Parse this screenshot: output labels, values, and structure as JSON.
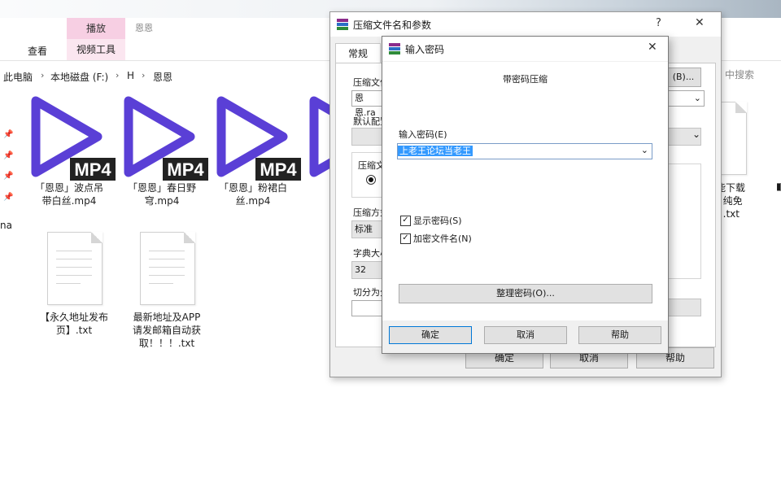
{
  "ribbon": {
    "play_tab": "播放",
    "context_title": "恩恩",
    "view_tab": "查看",
    "video_tools": "视频工具"
  },
  "address": {
    "crumbs": [
      "此电脑",
      "本地磁盘 (F:)",
      "H",
      "恩恩"
    ],
    "search_placeholder": "中搜索",
    "left_partial": "na"
  },
  "files": [
    {
      "name": "「恩恩」波点吊带白丝.mp4",
      "line1": "「恩恩」波点吊",
      "line2": "带白丝.mp4",
      "badge": "MP4"
    },
    {
      "name": "「恩恩」春日野穹.mp4",
      "line1": "「恩恩」春日野",
      "line2": "穹.mp4",
      "badge": "MP4"
    },
    {
      "name": "「恩恩」粉裙白丝.mp4",
      "line1": "「恩恩」粉裙白",
      "line2": "丝.mp4",
      "badge": "MP4"
    },
    {
      "name": "「",
      "line1": "「",
      "line2": "",
      "badge": ""
    },
    {
      "name": "【永久地址发布页】.txt",
      "line1": "【永久地址发布",
      "line2": "页】.txt"
    },
    {
      "name": "最新地址及APP请发邮箱自动获取！！！.txt",
      "line1": "最新地址及APP",
      "line2": "请发邮箱自动获",
      "line3": "取！！！.txt"
    },
    {
      "name": "能下载 纯免 .txt",
      "line1": "能下载",
      "line2": "! 纯免",
      "line3": "! .txt"
    }
  ],
  "archive_dialog": {
    "title": "压缩文件名和参数",
    "help_glyph": "?",
    "close_glyph": "✕",
    "tab_general": "常规",
    "archive_name_label": "压缩文件",
    "archive_name_value": "恩恩.ra",
    "browse_button": "(B)...",
    "default_profile_label": "默认配置",
    "format_label": "压缩文",
    "method_label": "压缩方式",
    "method_value": "标准",
    "dict_label": "字典大小",
    "dict_value": "32",
    "split_label": "切分为分",
    "ok_button": "确定",
    "cancel_button": "取消",
    "help_button": "帮助"
  },
  "password_dialog": {
    "title": "输入密码",
    "close_glyph": "✕",
    "subtitle": "带密码压缩",
    "enter_label": "输入密码(E)",
    "password_value": "上老王论坛当老王",
    "show_password": "显示密码(S)",
    "show_password_checked": true,
    "encrypt_names": "加密文件名(N)",
    "encrypt_names_checked": true,
    "organize_button": "整理密码(O)...",
    "ok_button": "确定",
    "cancel_button": "取消",
    "help_button": "帮助"
  },
  "colors": {
    "play_purple": "#5a3fd6",
    "ribbon_pink": "#f7cfe3",
    "selection_blue": "#3399ff"
  }
}
